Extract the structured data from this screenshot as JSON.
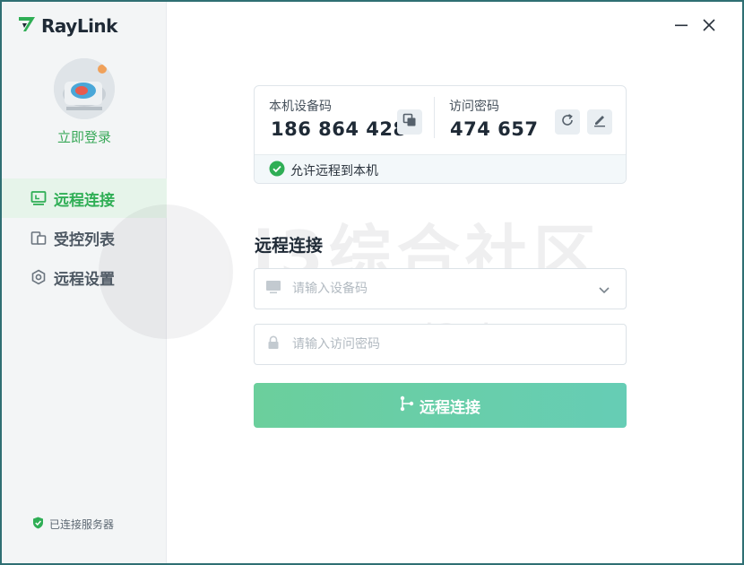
{
  "app": {
    "logo_text": "RayLink"
  },
  "sidebar": {
    "login_label": "立即登录",
    "nav": [
      {
        "label": "远程连接",
        "icon": "remote-desktop-icon",
        "active": true
      },
      {
        "label": "受控列表",
        "icon": "device-list-icon",
        "active": false
      },
      {
        "label": "远程设置",
        "icon": "settings-icon",
        "active": false
      }
    ],
    "server_status": "已连接服务器"
  },
  "device_card": {
    "device_code_label": "本机设备码",
    "device_code": "186 864 428",
    "access_password_label": "访问密码",
    "access_password": "474 657",
    "allow_remote_label": "允许远程到本机"
  },
  "connect_form": {
    "title": "远程连接",
    "device_placeholder": "请输入设备码",
    "password_placeholder": "请输入访问密码",
    "button_label": "远程连接"
  },
  "watermark": {
    "text": "i3综合社区",
    "url": "www.i3zh.com"
  },
  "colors": {
    "accent_green": "#2fae55",
    "button_gradient_start": "#6bcf9c",
    "button_gradient_end": "#66cdb5",
    "sidebar_bg": "#f3f5f6",
    "window_border": "#2f6f73"
  }
}
